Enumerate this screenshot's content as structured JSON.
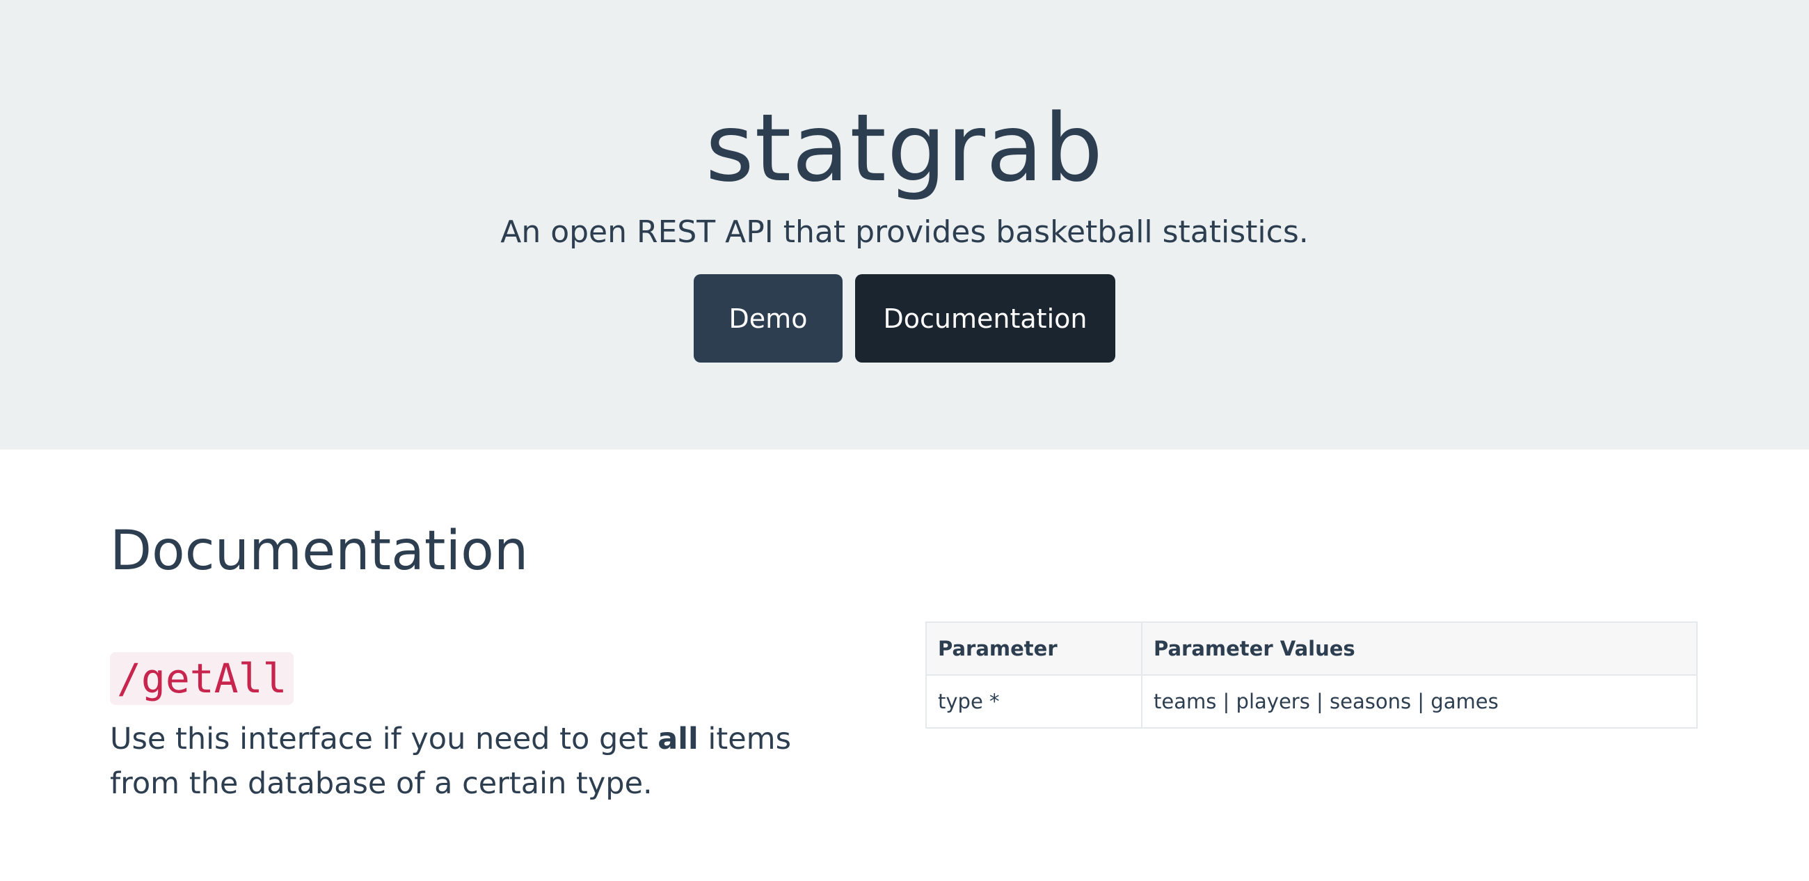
{
  "hero": {
    "title": "statgrab",
    "subtitle": "An open REST API that provides basketball statistics.",
    "buttons": {
      "demo": "Demo",
      "documentation": "Documentation"
    }
  },
  "documentation": {
    "heading": "Documentation",
    "endpoint": {
      "name": "/getAll",
      "desc_before": "Use this interface if you need to get ",
      "desc_bold": "all",
      "desc_after": " items from the database of a certain type."
    },
    "table": {
      "headers": [
        "Parameter",
        "Parameter Values"
      ],
      "rows": [
        [
          "type *",
          "teams | players | seasons | games"
        ]
      ]
    }
  },
  "colors": {
    "hero_bg": "#ecf0f1",
    "text": "#2c3e50",
    "demo_button": "#2c3e50",
    "docs_button": "#1b252f",
    "code_text": "#c7254e",
    "code_bg": "#f9eef1"
  }
}
